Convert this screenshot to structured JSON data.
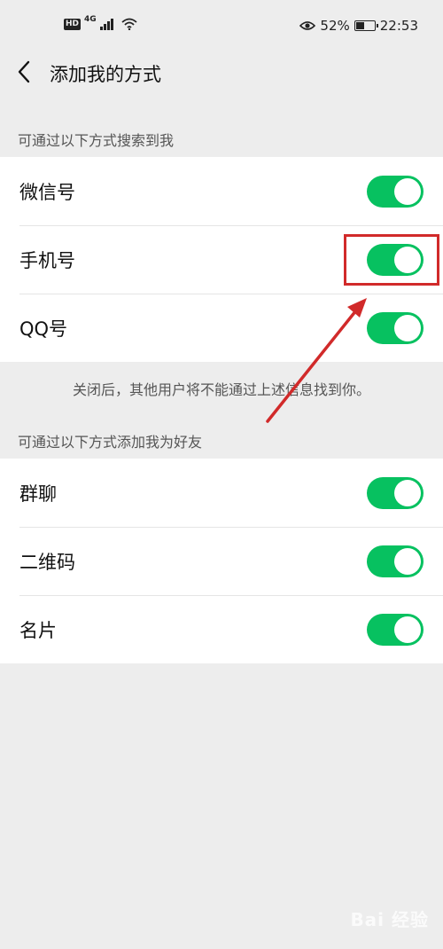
{
  "status_bar": {
    "hd_badge": "HD",
    "network": "4G",
    "battery_percent": "52%",
    "battery_level": 0.52,
    "time": "22:53"
  },
  "nav": {
    "title": "添加我的方式"
  },
  "search_section": {
    "header": "可通过以下方式搜索到我",
    "items": [
      {
        "label": "微信号",
        "enabled": true
      },
      {
        "label": "手机号",
        "enabled": true
      },
      {
        "label": "QQ号",
        "enabled": true
      }
    ],
    "note": "关闭后，其他用户将不能通过上述信息找到你。"
  },
  "add_section": {
    "header": "可通过以下方式添加我为好友",
    "items": [
      {
        "label": "群聊",
        "enabled": true
      },
      {
        "label": "二维码",
        "enabled": true
      },
      {
        "label": "名片",
        "enabled": true
      }
    ]
  },
  "watermark": "Bai 经验",
  "colors": {
    "toggle_on": "#07c160",
    "annotation": "#d12a2a",
    "background": "#ededed"
  }
}
